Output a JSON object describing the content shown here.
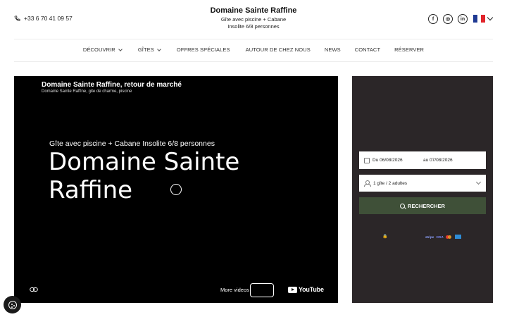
{
  "header": {
    "phone": "+33 6 70 41 09 57",
    "title": "Domaine Sainte Raffine",
    "subtitle_line1": "Gîte avec piscine + Cabane",
    "subtitle_line2": "Insolite 6/8 personnes",
    "socials": [
      {
        "icon": "facebook-icon",
        "glyph": "f"
      },
      {
        "icon": "instagram-icon",
        "glyph": "◎"
      },
      {
        "icon": "linkedin-icon",
        "glyph": "in"
      }
    ],
    "language_flag_colors": [
      "#1f3a93",
      "#ffffff",
      "#e1252b"
    ]
  },
  "nav": {
    "items": [
      {
        "label": "DÉCOUVRIR",
        "dropdown": true
      },
      {
        "label": "GÎTES",
        "dropdown": true
      },
      {
        "label": "OFFRES SPÉCIALES",
        "dropdown": false
      },
      {
        "label": "AUTOUR DE CHEZ NOUS",
        "dropdown": false
      },
      {
        "label": "NEWS",
        "dropdown": false
      },
      {
        "label": "CONTACT",
        "dropdown": false
      },
      {
        "label": "RÉSERVER",
        "dropdown": false
      }
    ]
  },
  "video": {
    "title": "Domaine Sainte Raffine, retour de marché",
    "channel_text": "Domaine Sainte Raffine, gite de charme, piscine",
    "hero_subtitle": "Gîte avec piscine + Cabane Insolite 6/8 personnes",
    "hero_title": "Domaine Sainte Raffine",
    "more_videos": "More videos",
    "youtube_label": "YouTube"
  },
  "booking": {
    "date_from": "Du 06/08/2026",
    "date_to": "au 07/08/2026",
    "guests": "1 gîte / 2 adultes",
    "search_label": "RECHERCHER",
    "payment_methods": [
      "stripe",
      "VISA",
      "mastercard",
      "amex"
    ],
    "search_color": "#3f5038",
    "panel_color": "#2b2628"
  }
}
